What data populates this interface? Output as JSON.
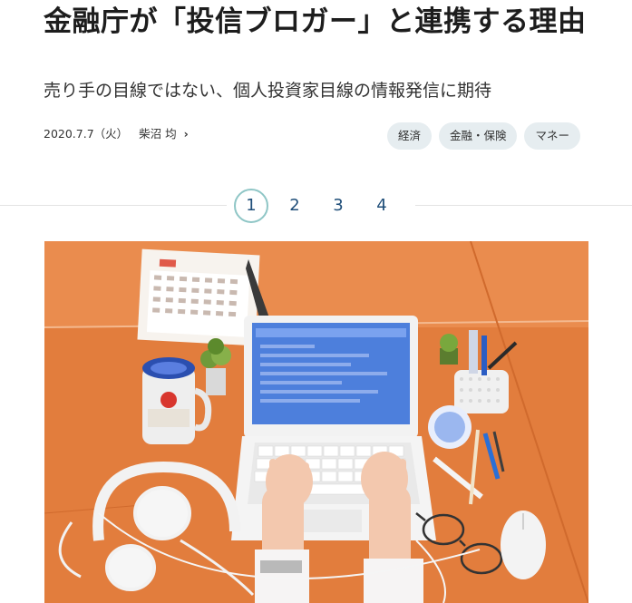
{
  "article": {
    "title": "金融庁が「投信ブロガー」と連携する理由",
    "subtitle": "売り手の目線ではない、個人投資家目線の情報発信に期待",
    "date": "2020.7.7（火）",
    "author": "柴沼 均",
    "author_chevron": "›"
  },
  "tags": [
    {
      "label": "経済"
    },
    {
      "label": "金融・保険"
    },
    {
      "label": "マネー"
    }
  ],
  "pagination": {
    "pages": [
      "1",
      "2",
      "3",
      "4"
    ],
    "current": "1"
  },
  "photo": {
    "description_items": [
      "calendar-icon",
      "laptop-icon",
      "headphones-icon",
      "mug-icon",
      "pen-holder-icon",
      "mouse-icon",
      "glasses-icon",
      "plant-icon"
    ],
    "colors": {
      "table": "#e07a3a",
      "table_light": "#ec955a",
      "laptop": "#f2f2f2",
      "screen": "#4f7fd8"
    }
  }
}
